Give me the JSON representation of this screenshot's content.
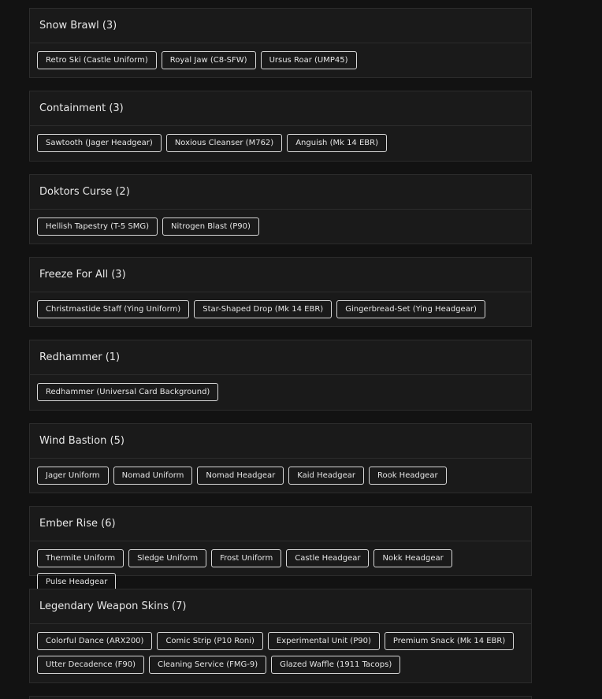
{
  "groups": [
    {
      "title": "Snow Brawl (3)",
      "items": [
        "Retro Ski (Castle Uniform)",
        "Royal Jaw (C8-SFW)",
        "Ursus Roar (UMP45)"
      ]
    },
    {
      "title": "Containment (3)",
      "items": [
        "Sawtooth (Jager Headgear)",
        "Noxious Cleanser (M762)",
        "Anguish (Mk 14 EBR)"
      ]
    },
    {
      "title": "Doktors Curse (2)",
      "items": [
        "Hellish Tapestry (T-5 SMG)",
        "Nitrogen Blast (P90)"
      ]
    },
    {
      "title": "Freeze For All (3)",
      "items": [
        "Christmastide Staff (Ying Uniform)",
        "Star-Shaped Drop (Mk 14 EBR)",
        "Gingerbread-Set (Ying Headgear)"
      ]
    },
    {
      "title": "Redhammer (1)",
      "items": [
        "Redhammer (Universal Card Background)"
      ]
    },
    {
      "title": "Wind Bastion (5)",
      "items": [
        "Jager Uniform",
        "Nomad Uniform",
        "Nomad Headgear",
        "Kaid Headgear",
        "Rook Headgear"
      ]
    },
    {
      "title": "Ember Rise (6)",
      "items": [
        "Thermite Uniform",
        "Sledge Uniform",
        "Frost Uniform",
        "Castle Headgear",
        "Nokk Headgear",
        "Pulse Headgear"
      ]
    },
    {
      "title": "Legendary Weapon Skins (7)",
      "items": [
        "Colorful Dance (ARX200)",
        "Comic Strip (P10 Roni)",
        "Experimental Unit (P90)",
        "Premium Snack (Mk 14 EBR)",
        "Utter Decadence (F90)",
        "Cleaning Service (FMG-9)",
        "Glazed Waffle (1911 Tacops)"
      ]
    }
  ]
}
